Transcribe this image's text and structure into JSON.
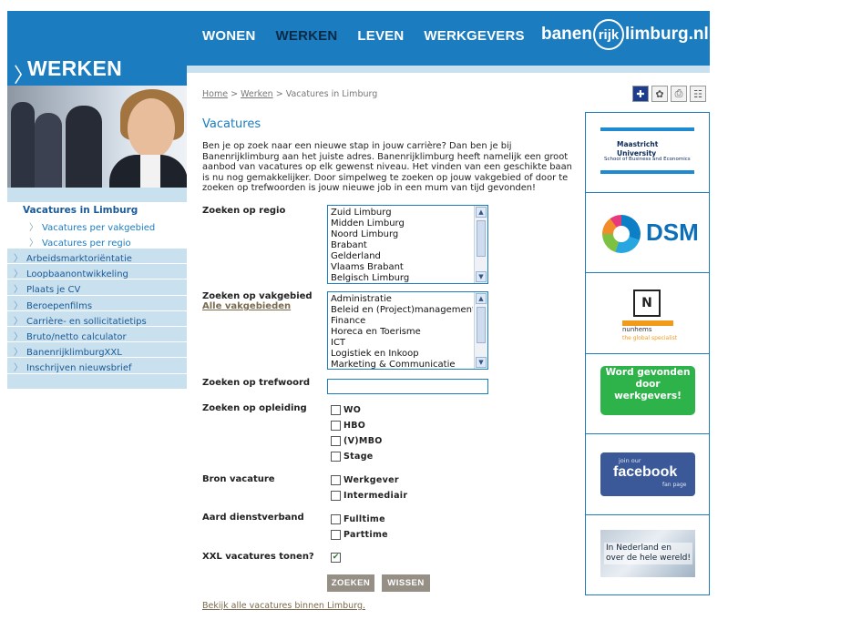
{
  "nav": {
    "items": [
      "WONEN",
      "WERKEN",
      "LEVEN",
      "WERKGEVERS"
    ],
    "active": "WERKEN"
  },
  "logo": {
    "pre": "banen",
    "ring": "rijk",
    "post": "limburg.nl"
  },
  "sidebar": {
    "title": "WERKEN",
    "current": "Vacatures in Limburg",
    "subitems": [
      "Vacatures per vakgebied",
      "Vacatures per regio"
    ],
    "menu": [
      "Arbeidsmarktoriëntatie",
      "Loopbaanontwikkeling",
      "Plaats je CV",
      "Beroepenfilms",
      "Carrière- en sollicitatietips",
      "Bruto/netto calculator",
      "BanenrijklimburgXXL",
      "Inschrijven nieuwsbrief"
    ]
  },
  "breadcrumb": {
    "home": "Home",
    "sep1": " > ",
    "werken": "Werken",
    "sep2": " > ",
    "current": "Vacatures in Limburg"
  },
  "heading": "Vacatures",
  "intro": "Ben je op zoek naar een nieuwe stap in jouw carrière? Dan ben je bij Banenrijklimburg aan het juiste adres. Banenrijklimburg heeft namelijk een groot aanbod van vacatures op elk gewenst niveau. Het vinden van een geschikte baan is nu nog gemakkelijker. Door simpelweg te zoeken op jouw vakgebied of door te zoeken op trefwoorden is jouw nieuwe job in een mum van tijd gevonden!",
  "form": {
    "regio_label": "Zoeken op regio",
    "regio_options": [
      "Zuid Limburg",
      "Midden Limburg",
      "Noord Limburg",
      "Brabant",
      "Gelderland",
      "Vlaams Brabant",
      "Belgisch Limburg"
    ],
    "vakgebied_label": "Zoeken op vakgebied",
    "vakgebied_link": "Alle vakgebieden",
    "vakgebied_options": [
      "Administratie",
      "Beleid en (Project)management",
      "Finance",
      "Horeca en Toerisme",
      "ICT",
      "Logistiek en Inkoop",
      "Marketing & Communicatie"
    ],
    "trefwoord_label": "Zoeken op trefwoord",
    "trefwoord_value": "",
    "opleiding_label": "Zoeken op opleiding",
    "opleiding_options": [
      "WO",
      "HBO",
      "(V)MBO",
      "Stage"
    ],
    "bron_label": "Bron vacature",
    "bron_options": [
      "Werkgever",
      "Intermediair"
    ],
    "aard_label": "Aard dienstverband",
    "aard_options": [
      "Fulltime",
      "Parttime"
    ],
    "xxl_label": "XXL vacatures tonen?",
    "xxl_checked": "✔",
    "zoeken_btn": "ZOEKEN",
    "wissen_btn": "WISSEN",
    "all_link": "Bekijk alle vacatures binnen Limburg."
  },
  "ads": {
    "maastricht": {
      "title": "Maastricht University",
      "subtitle": "School of Business and Economics"
    },
    "dsm": {
      "name": "DSM"
    },
    "nunhems": {
      "name": "nunhems",
      "slogan": "the global specialist"
    },
    "word": {
      "text": "Word gevonden door werkgevers!"
    },
    "facebook": {
      "pre": "join our",
      "name": "facebook",
      "post": "fan page"
    },
    "nederland": {
      "line1": "In Nederland en",
      "line2": "over de hele wereld!"
    }
  },
  "colors": {
    "brand_blue": "#1b7cc0",
    "light_blue": "#c9e0ef",
    "button_gray": "#968f86",
    "green_ad": "#2eb24a"
  }
}
